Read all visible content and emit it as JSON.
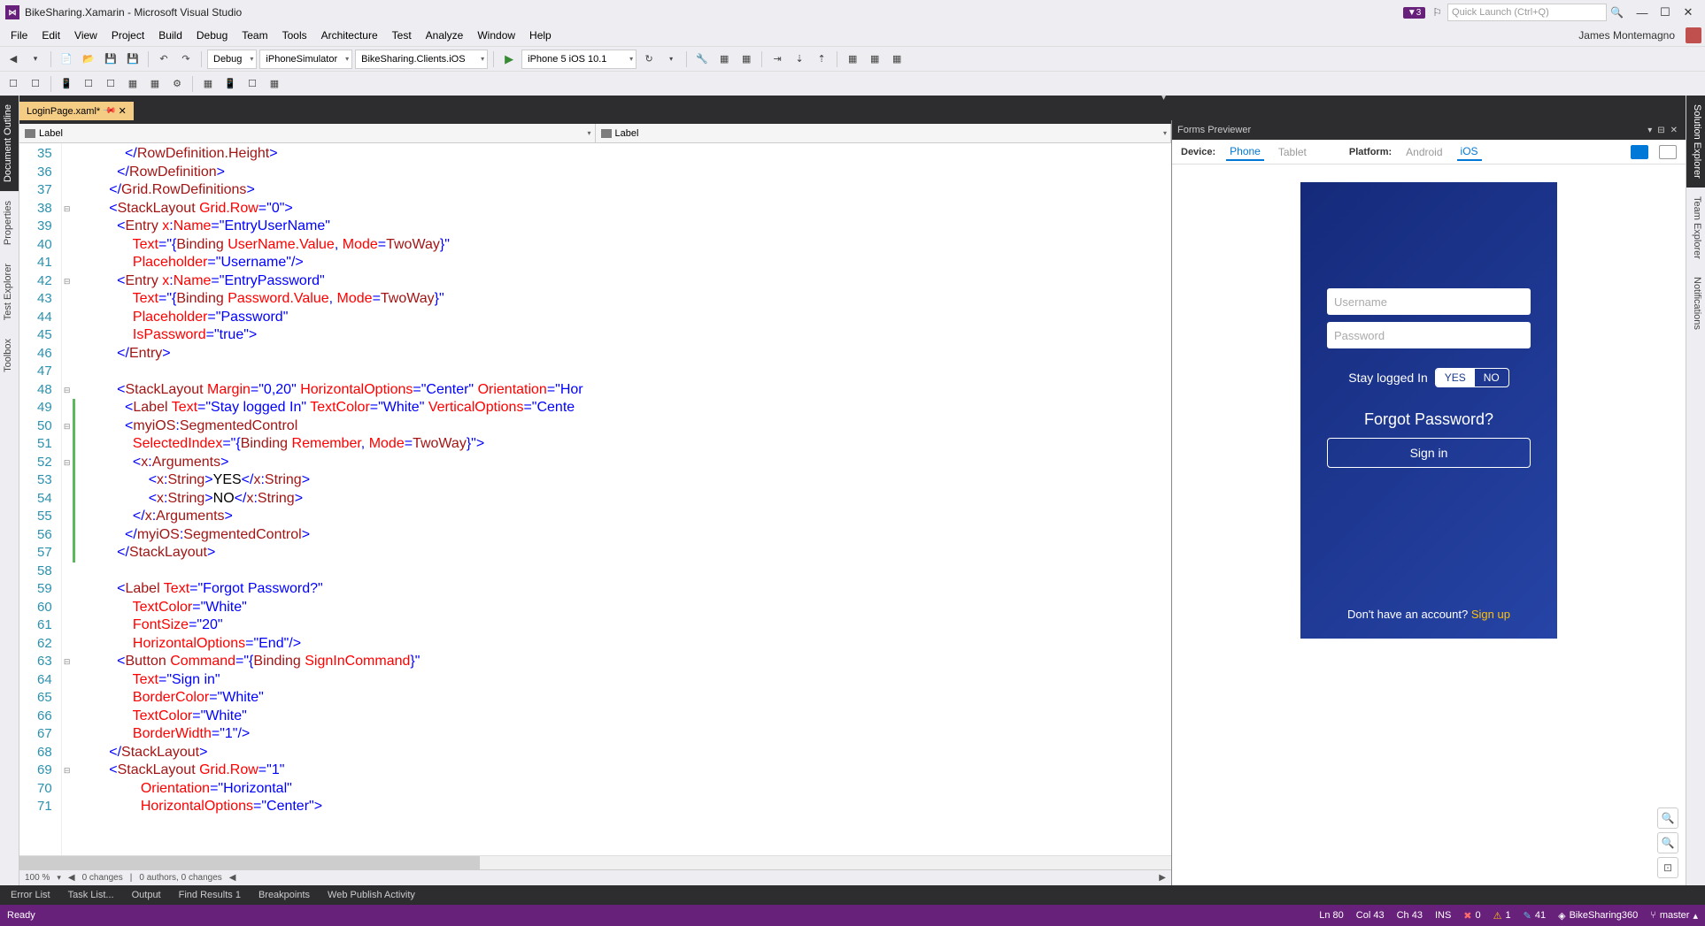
{
  "titlebar": {
    "title": "BikeSharing.Xamarin - Microsoft Visual Studio",
    "notif_count": "3",
    "quicklaunch_placeholder": "Quick Launch (Ctrl+Q)"
  },
  "menubar": {
    "items": [
      "File",
      "Edit",
      "View",
      "Project",
      "Build",
      "Debug",
      "Team",
      "Tools",
      "Architecture",
      "Test",
      "Analyze",
      "Window",
      "Help"
    ],
    "user": "James Montemagno"
  },
  "toolbar": {
    "config": "Debug",
    "platform": "iPhoneSimulator",
    "project": "BikeSharing.Clients.iOS",
    "target": "iPhone 5 iOS 10.1"
  },
  "tab": {
    "name": "LoginPage.xaml*"
  },
  "editor_dropdowns": {
    "left": "Label",
    "right": "Label"
  },
  "code_lines": [
    {
      "n": 35,
      "indent": 12,
      "parts": [
        {
          "t": "</",
          "c": "t-brace"
        },
        {
          "t": "RowDefinition.Height",
          "c": "t-tag"
        },
        {
          "t": ">",
          "c": "t-brace"
        }
      ]
    },
    {
      "n": 36,
      "indent": 10,
      "parts": [
        {
          "t": "</",
          "c": "t-brace"
        },
        {
          "t": "RowDefinition",
          "c": "t-tag"
        },
        {
          "t": ">",
          "c": "t-brace"
        }
      ]
    },
    {
      "n": 37,
      "indent": 8,
      "parts": [
        {
          "t": "</",
          "c": "t-brace"
        },
        {
          "t": "Grid.RowDefinitions",
          "c": "t-tag"
        },
        {
          "t": ">",
          "c": "t-brace"
        }
      ]
    },
    {
      "n": 38,
      "indent": 8,
      "fold": "-",
      "parts": [
        {
          "t": "<",
          "c": "t-brace"
        },
        {
          "t": "StackLayout",
          "c": "t-tag"
        },
        {
          "t": " ",
          "c": ""
        },
        {
          "t": "Grid.Row",
          "c": "t-attr"
        },
        {
          "t": "=",
          "c": "t-brace"
        },
        {
          "t": "\"0\"",
          "c": "t-str"
        },
        {
          "t": ">",
          "c": "t-brace"
        }
      ]
    },
    {
      "n": 39,
      "indent": 10,
      "parts": [
        {
          "t": "<",
          "c": "t-brace"
        },
        {
          "t": "Entry",
          "c": "t-tag"
        },
        {
          "t": " ",
          "c": ""
        },
        {
          "t": "x",
          "c": "t-attr"
        },
        {
          "t": ":",
          "c": "t-brace"
        },
        {
          "t": "Name",
          "c": "t-attr"
        },
        {
          "t": "=",
          "c": "t-brace"
        },
        {
          "t": "\"EntryUserName\"",
          "c": "t-str"
        }
      ]
    },
    {
      "n": 40,
      "indent": 14,
      "parts": [
        {
          "t": "Text",
          "c": "t-attr"
        },
        {
          "t": "=",
          "c": "t-brace"
        },
        {
          "t": "\"",
          "c": "t-str"
        },
        {
          "t": "{",
          "c": "t-brace"
        },
        {
          "t": "Binding",
          "c": "t-bind"
        },
        {
          "t": " ",
          "c": ""
        },
        {
          "t": "UserName.Value",
          "c": "t-bindkey"
        },
        {
          "t": ",",
          "c": "t-brace"
        },
        {
          "t": " ",
          "c": ""
        },
        {
          "t": "Mode",
          "c": "t-bindkey"
        },
        {
          "t": "=",
          "c": "t-brace"
        },
        {
          "t": "TwoWay",
          "c": "t-bind"
        },
        {
          "t": "}",
          "c": "t-brace"
        },
        {
          "t": "\"",
          "c": "t-str"
        }
      ]
    },
    {
      "n": 41,
      "indent": 14,
      "parts": [
        {
          "t": "Placeholder",
          "c": "t-attr"
        },
        {
          "t": "=",
          "c": "t-brace"
        },
        {
          "t": "\"Username\"",
          "c": "t-str"
        },
        {
          "t": "/>",
          "c": "t-brace"
        }
      ]
    },
    {
      "n": 42,
      "indent": 10,
      "fold": "-",
      "parts": [
        {
          "t": "<",
          "c": "t-brace"
        },
        {
          "t": "Entry",
          "c": "t-tag"
        },
        {
          "t": " ",
          "c": ""
        },
        {
          "t": "x",
          "c": "t-attr"
        },
        {
          "t": ":",
          "c": "t-brace"
        },
        {
          "t": "Name",
          "c": "t-attr"
        },
        {
          "t": "=",
          "c": "t-brace"
        },
        {
          "t": "\"EntryPassword\"",
          "c": "t-str"
        }
      ]
    },
    {
      "n": 43,
      "indent": 14,
      "parts": [
        {
          "t": "Text",
          "c": "t-attr"
        },
        {
          "t": "=",
          "c": "t-brace"
        },
        {
          "t": "\"",
          "c": "t-str"
        },
        {
          "t": "{",
          "c": "t-brace"
        },
        {
          "t": "Binding",
          "c": "t-bind"
        },
        {
          "t": " ",
          "c": ""
        },
        {
          "t": "Password.Value",
          "c": "t-bindkey"
        },
        {
          "t": ",",
          "c": "t-brace"
        },
        {
          "t": " ",
          "c": ""
        },
        {
          "t": "Mode",
          "c": "t-bindkey"
        },
        {
          "t": "=",
          "c": "t-brace"
        },
        {
          "t": "TwoWay",
          "c": "t-bind"
        },
        {
          "t": "}",
          "c": "t-brace"
        },
        {
          "t": "\"",
          "c": "t-str"
        }
      ]
    },
    {
      "n": 44,
      "indent": 14,
      "parts": [
        {
          "t": "Placeholder",
          "c": "t-attr"
        },
        {
          "t": "=",
          "c": "t-brace"
        },
        {
          "t": "\"Password\"",
          "c": "t-str"
        }
      ]
    },
    {
      "n": 45,
      "indent": 14,
      "parts": [
        {
          "t": "IsPassword",
          "c": "t-attr"
        },
        {
          "t": "=",
          "c": "t-brace"
        },
        {
          "t": "\"true\"",
          "c": "t-str"
        },
        {
          "t": ">",
          "c": "t-brace"
        }
      ]
    },
    {
      "n": 46,
      "indent": 10,
      "parts": [
        {
          "t": "</",
          "c": "t-brace"
        },
        {
          "t": "Entry",
          "c": "t-tag"
        },
        {
          "t": ">",
          "c": "t-brace"
        }
      ]
    },
    {
      "n": 47,
      "indent": 0,
      "parts": []
    },
    {
      "n": 48,
      "indent": 10,
      "fold": "-",
      "parts": [
        {
          "t": "<",
          "c": "t-brace"
        },
        {
          "t": "StackLayout",
          "c": "t-tag"
        },
        {
          "t": " ",
          "c": ""
        },
        {
          "t": "Margin",
          "c": "t-attr"
        },
        {
          "t": "=",
          "c": "t-brace"
        },
        {
          "t": "\"0,20\"",
          "c": "t-str"
        },
        {
          "t": " ",
          "c": ""
        },
        {
          "t": "HorizontalOptions",
          "c": "t-attr"
        },
        {
          "t": "=",
          "c": "t-brace"
        },
        {
          "t": "\"Center\"",
          "c": "t-str"
        },
        {
          "t": " ",
          "c": ""
        },
        {
          "t": "Orientation",
          "c": "t-attr"
        },
        {
          "t": "=",
          "c": "t-brace"
        },
        {
          "t": "\"Hor",
          "c": "t-str"
        }
      ]
    },
    {
      "n": 49,
      "indent": 12,
      "green": true,
      "parts": [
        {
          "t": "<",
          "c": "t-brace"
        },
        {
          "t": "Label",
          "c": "t-tag"
        },
        {
          "t": " ",
          "c": ""
        },
        {
          "t": "Text",
          "c": "t-attr"
        },
        {
          "t": "=",
          "c": "t-brace"
        },
        {
          "t": "\"Stay logged In\"",
          "c": "t-str"
        },
        {
          "t": " ",
          "c": ""
        },
        {
          "t": "TextColor",
          "c": "t-attr"
        },
        {
          "t": "=",
          "c": "t-brace"
        },
        {
          "t": "\"White\"",
          "c": "t-str"
        },
        {
          "t": " ",
          "c": ""
        },
        {
          "t": "VerticalOptions",
          "c": "t-attr"
        },
        {
          "t": "=",
          "c": "t-brace"
        },
        {
          "t": "\"Cente",
          "c": "t-str"
        }
      ]
    },
    {
      "n": 50,
      "indent": 12,
      "fold": "-",
      "green": true,
      "parts": [
        {
          "t": "<",
          "c": "t-brace"
        },
        {
          "t": "myiOS",
          "c": "t-tag"
        },
        {
          "t": ":",
          "c": "t-brace"
        },
        {
          "t": "SegmentedControl",
          "c": "t-tag"
        }
      ]
    },
    {
      "n": 51,
      "indent": 14,
      "green": true,
      "parts": [
        {
          "t": "SelectedIndex",
          "c": "t-attr"
        },
        {
          "t": "=",
          "c": "t-brace"
        },
        {
          "t": "\"",
          "c": "t-str"
        },
        {
          "t": "{",
          "c": "t-brace"
        },
        {
          "t": "Binding",
          "c": "t-bind"
        },
        {
          "t": " ",
          "c": ""
        },
        {
          "t": "Remember",
          "c": "t-bindkey"
        },
        {
          "t": ",",
          "c": "t-brace"
        },
        {
          "t": " ",
          "c": ""
        },
        {
          "t": "Mode",
          "c": "t-bindkey"
        },
        {
          "t": "=",
          "c": "t-brace"
        },
        {
          "t": "TwoWay",
          "c": "t-bind"
        },
        {
          "t": "}",
          "c": "t-brace"
        },
        {
          "t": "\"",
          "c": "t-str"
        },
        {
          "t": ">",
          "c": "t-brace"
        }
      ]
    },
    {
      "n": 52,
      "indent": 14,
      "fold": "-",
      "green": true,
      "parts": [
        {
          "t": "<",
          "c": "t-brace"
        },
        {
          "t": "x",
          "c": "t-tag"
        },
        {
          "t": ":",
          "c": "t-brace"
        },
        {
          "t": "Arguments",
          "c": "t-tag"
        },
        {
          "t": ">",
          "c": "t-brace"
        }
      ]
    },
    {
      "n": 53,
      "indent": 18,
      "green": true,
      "parts": [
        {
          "t": "<",
          "c": "t-brace"
        },
        {
          "t": "x",
          "c": "t-tag"
        },
        {
          "t": ":",
          "c": "t-brace"
        },
        {
          "t": "String",
          "c": "t-tag"
        },
        {
          "t": ">",
          "c": "t-brace"
        },
        {
          "t": "YES",
          "c": "t-text"
        },
        {
          "t": "</",
          "c": "t-brace"
        },
        {
          "t": "x",
          "c": "t-tag"
        },
        {
          "t": ":",
          "c": "t-brace"
        },
        {
          "t": "String",
          "c": "t-tag"
        },
        {
          "t": ">",
          "c": "t-brace"
        }
      ]
    },
    {
      "n": 54,
      "indent": 18,
      "green": true,
      "parts": [
        {
          "t": "<",
          "c": "t-brace"
        },
        {
          "t": "x",
          "c": "t-tag"
        },
        {
          "t": ":",
          "c": "t-brace"
        },
        {
          "t": "String",
          "c": "t-tag"
        },
        {
          "t": ">",
          "c": "t-brace"
        },
        {
          "t": "NO",
          "c": "t-text"
        },
        {
          "t": "</",
          "c": "t-brace"
        },
        {
          "t": "x",
          "c": "t-tag"
        },
        {
          "t": ":",
          "c": "t-brace"
        },
        {
          "t": "String",
          "c": "t-tag"
        },
        {
          "t": ">",
          "c": "t-brace"
        }
      ]
    },
    {
      "n": 55,
      "indent": 14,
      "green": true,
      "parts": [
        {
          "t": "</",
          "c": "t-brace"
        },
        {
          "t": "x",
          "c": "t-tag"
        },
        {
          "t": ":",
          "c": "t-brace"
        },
        {
          "t": "Arguments",
          "c": "t-tag"
        },
        {
          "t": ">",
          "c": "t-brace"
        }
      ]
    },
    {
      "n": 56,
      "indent": 12,
      "green": true,
      "parts": [
        {
          "t": "</",
          "c": "t-brace"
        },
        {
          "t": "myiOS",
          "c": "t-tag"
        },
        {
          "t": ":",
          "c": "t-brace"
        },
        {
          "t": "SegmentedControl",
          "c": "t-tag"
        },
        {
          "t": ">",
          "c": "t-brace"
        }
      ]
    },
    {
      "n": 57,
      "indent": 10,
      "green": true,
      "parts": [
        {
          "t": "</",
          "c": "t-brace"
        },
        {
          "t": "StackLayout",
          "c": "t-tag"
        },
        {
          "t": ">",
          "c": "t-brace"
        }
      ]
    },
    {
      "n": 58,
      "indent": 0,
      "parts": []
    },
    {
      "n": 59,
      "indent": 10,
      "parts": [
        {
          "t": "<",
          "c": "t-brace"
        },
        {
          "t": "Label",
          "c": "t-tag"
        },
        {
          "t": " ",
          "c": ""
        },
        {
          "t": "Text",
          "c": "t-attr"
        },
        {
          "t": "=",
          "c": "t-brace"
        },
        {
          "t": "\"Forgot Password?\"",
          "c": "t-str"
        }
      ]
    },
    {
      "n": 60,
      "indent": 14,
      "parts": [
        {
          "t": "TextColor",
          "c": "t-attr"
        },
        {
          "t": "=",
          "c": "t-brace"
        },
        {
          "t": "\"White\"",
          "c": "t-str"
        }
      ]
    },
    {
      "n": 61,
      "indent": 14,
      "parts": [
        {
          "t": "FontSize",
          "c": "t-attr"
        },
        {
          "t": "=",
          "c": "t-brace"
        },
        {
          "t": "\"20\"",
          "c": "t-str"
        }
      ]
    },
    {
      "n": 62,
      "indent": 14,
      "parts": [
        {
          "t": "HorizontalOptions",
          "c": "t-attr"
        },
        {
          "t": "=",
          "c": "t-brace"
        },
        {
          "t": "\"End\"",
          "c": "t-str"
        },
        {
          "t": "/>",
          "c": "t-brace"
        }
      ]
    },
    {
      "n": 63,
      "indent": 10,
      "fold": "-",
      "parts": [
        {
          "t": "<",
          "c": "t-brace"
        },
        {
          "t": "Button",
          "c": "t-tag"
        },
        {
          "t": " ",
          "c": ""
        },
        {
          "t": "Command",
          "c": "t-attr"
        },
        {
          "t": "=",
          "c": "t-brace"
        },
        {
          "t": "\"",
          "c": "t-str"
        },
        {
          "t": "{",
          "c": "t-brace"
        },
        {
          "t": "Binding",
          "c": "t-bind"
        },
        {
          "t": " ",
          "c": ""
        },
        {
          "t": "SignInCommand",
          "c": "t-bindkey"
        },
        {
          "t": "}",
          "c": "t-brace"
        },
        {
          "t": "\"",
          "c": "t-str"
        }
      ]
    },
    {
      "n": 64,
      "indent": 14,
      "parts": [
        {
          "t": "Text",
          "c": "t-attr"
        },
        {
          "t": "=",
          "c": "t-brace"
        },
        {
          "t": "\"Sign in\"",
          "c": "t-str"
        }
      ]
    },
    {
      "n": 65,
      "indent": 14,
      "parts": [
        {
          "t": "BorderColor",
          "c": "t-attr"
        },
        {
          "t": "=",
          "c": "t-brace"
        },
        {
          "t": "\"White\"",
          "c": "t-str"
        }
      ]
    },
    {
      "n": 66,
      "indent": 14,
      "parts": [
        {
          "t": "TextColor",
          "c": "t-attr"
        },
        {
          "t": "=",
          "c": "t-brace"
        },
        {
          "t": "\"White\"",
          "c": "t-str"
        }
      ]
    },
    {
      "n": 67,
      "indent": 14,
      "parts": [
        {
          "t": "BorderWidth",
          "c": "t-attr"
        },
        {
          "t": "=",
          "c": "t-brace"
        },
        {
          "t": "\"1\"",
          "c": "t-str"
        },
        {
          "t": "/>",
          "c": "t-brace"
        }
      ]
    },
    {
      "n": 68,
      "indent": 8,
      "parts": [
        {
          "t": "</",
          "c": "t-brace"
        },
        {
          "t": "StackLayout",
          "c": "t-tag"
        },
        {
          "t": ">",
          "c": "t-brace"
        }
      ]
    },
    {
      "n": 69,
      "indent": 8,
      "fold": "-",
      "parts": [
        {
          "t": "<",
          "c": "t-brace"
        },
        {
          "t": "StackLayout",
          "c": "t-tag"
        },
        {
          "t": " ",
          "c": ""
        },
        {
          "t": "Grid.Row",
          "c": "t-attr"
        },
        {
          "t": "=",
          "c": "t-brace"
        },
        {
          "t": "\"1\"",
          "c": "t-str"
        }
      ]
    },
    {
      "n": 70,
      "indent": 16,
      "parts": [
        {
          "t": "Orientation",
          "c": "t-attr"
        },
        {
          "t": "=",
          "c": "t-brace"
        },
        {
          "t": "\"Horizontal\"",
          "c": "t-str"
        }
      ]
    },
    {
      "n": 71,
      "indent": 16,
      "parts": [
        {
          "t": "HorizontalOptions",
          "c": "t-attr"
        },
        {
          "t": "=",
          "c": "t-brace"
        },
        {
          "t": "\"Center\"",
          "c": "t-str"
        },
        {
          "t": ">",
          "c": "t-brace"
        }
      ]
    }
  ],
  "editor_status": {
    "zoom": "100 %",
    "changes1": "0 changes",
    "changes2": "0 authors, 0 changes"
  },
  "left_rail": [
    "Document Outline",
    "Properties",
    "Test Explorer",
    "Toolbox"
  ],
  "right_rail": [
    "Solution Explorer",
    "Team Explorer",
    "Notifications"
  ],
  "previewer": {
    "title": "Forms Previewer",
    "device_label": "Device:",
    "device_opts": [
      "Phone",
      "Tablet"
    ],
    "platform_label": "Platform:",
    "platform_opts": [
      "Android",
      "iOS"
    ]
  },
  "phone": {
    "username_placeholder": "Username",
    "password_placeholder": "Password",
    "stay_label": "Stay logged In",
    "seg_yes": "YES",
    "seg_no": "NO",
    "forgot": "Forgot Password?",
    "signin": "Sign in",
    "footer_text": "Don't have an account? ",
    "signup": "Sign up"
  },
  "bottom_tabs": [
    "Error List",
    "Task List...",
    "Output",
    "Find Results 1",
    "Breakpoints",
    "Web Publish Activity"
  ],
  "statusbar": {
    "ready": "Ready",
    "ln": "Ln 80",
    "col": "Col 43",
    "ch": "Ch 43",
    "ins": "INS",
    "errors": "0",
    "warnings": "1",
    "msgs": "41",
    "project": "BikeSharing360",
    "branch": "master"
  }
}
